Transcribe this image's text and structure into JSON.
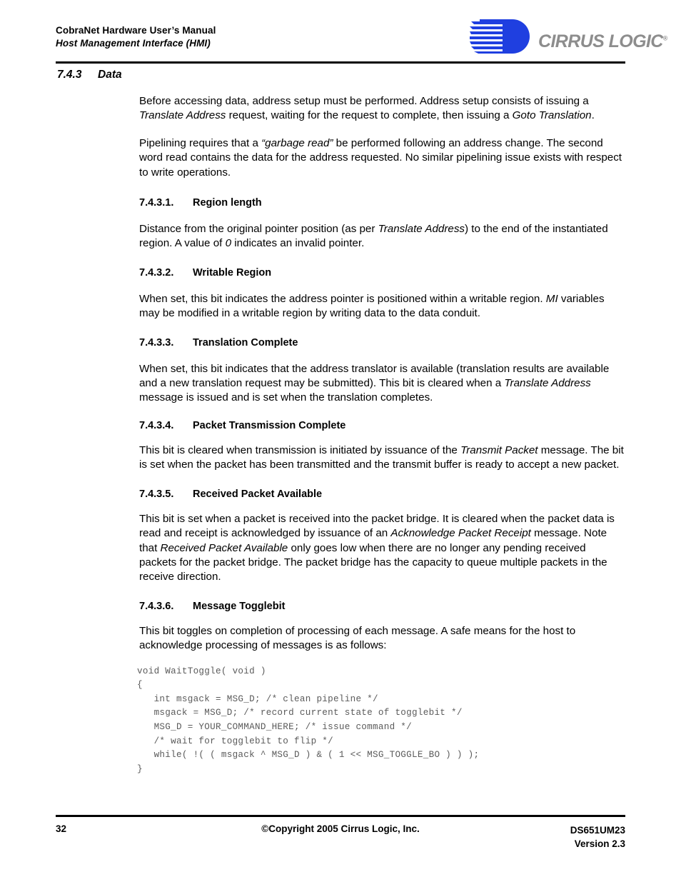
{
  "header": {
    "manual_title": "CobraNet Hardware User’s Manual",
    "chapter_title": "Host Management Interface (HMI)",
    "logo": {
      "name": "cirrus-logic-logo",
      "text": "CIRRUS LOGIC",
      "trademark": "®",
      "mark_color": "#1f3fe0",
      "text_color": "#8d8d8d"
    }
  },
  "section": {
    "number": "7.4.3",
    "title": "Data",
    "intro_paragraphs": [
      {
        "runs": [
          {
            "t": "Before accessing data, address setup must be performed. Address setup consists of issuing a "
          },
          {
            "t": "Translate Address",
            "i": true
          },
          {
            "t": " request, waiting for the request to complete, then issuing a "
          },
          {
            "t": "Goto Translation",
            "i": true
          },
          {
            "t": "."
          }
        ]
      },
      {
        "runs": [
          {
            "t": "Pipelining requires that a "
          },
          {
            "t": "“garbage read”",
            "i": true
          },
          {
            "t": " be performed following an address change. The second word read contains the data for the address requested. No similar pipelining issue exists with respect to write operations."
          }
        ]
      }
    ],
    "subsections": [
      {
        "number": "7.4.3.1.",
        "title": "Region length",
        "paragraphs": [
          {
            "runs": [
              {
                "t": "Distance from the original pointer position (as per "
              },
              {
                "t": "Translate Address",
                "i": true
              },
              {
                "t": ") to the end of the instantiated region. A value of "
              },
              {
                "t": "0",
                "i": true
              },
              {
                "t": " indicates an invalid pointer."
              }
            ]
          }
        ]
      },
      {
        "number": "7.4.3.2.",
        "title": "Writable Region",
        "paragraphs": [
          {
            "runs": [
              {
                "t": "When set, this bit indicates the address pointer is positioned within a writable region. "
              },
              {
                "t": "MI",
                "i": true
              },
              {
                "t": " variables may be modified in a writable region by writing data to the data conduit."
              }
            ]
          }
        ]
      },
      {
        "number": "7.4.3.3.",
        "title": "Translation Complete",
        "paragraphs": [
          {
            "runs": [
              {
                "t": "When set, this bit indicates that the address translator is available (translation results are available and a new translation request may be submitted). This bit is cleared when a "
              },
              {
                "t": "Translate Address",
                "i": true
              },
              {
                "t": " message is issued and is set when the translation completes."
              }
            ]
          }
        ]
      },
      {
        "number": "7.4.3.4.",
        "title": "Packet Transmission Complete",
        "paragraphs": [
          {
            "runs": [
              {
                "t": "This bit is cleared when transmission is initiated by issuance of the "
              },
              {
                "t": "Transmit Packet",
                "i": true
              },
              {
                "t": " message. The bit is set when the packet has been transmitted and the transmit buffer is ready to accept a new packet."
              }
            ]
          }
        ]
      },
      {
        "number": "7.4.3.5.",
        "title": "Received Packet Available",
        "paragraphs": [
          {
            "runs": [
              {
                "t": "This bit is set when a packet is received into the packet bridge. It is cleared when the packet data is read and receipt is acknowledged by issuance of an "
              },
              {
                "t": "Acknowledge Packet Receipt",
                "i": true
              },
              {
                "t": " message. Note that "
              },
              {
                "t": "Received Packet Available",
                "i": true
              },
              {
                "t": " only goes low when there are no longer any pending received packets for the packet bridge. The packet bridge has the capacity to queue multiple packets in the receive direction."
              }
            ]
          }
        ]
      },
      {
        "number": "7.4.3.6.",
        "title": "Message Togglebit",
        "paragraphs": [
          {
            "runs": [
              {
                "t": "This bit toggles on completion of processing of each message. A safe means for the host to acknowledge processing of messages is as follows:"
              }
            ]
          }
        ]
      }
    ],
    "code_listing": "void WaitToggle( void )\n{\n   int msgack = MSG_D; /* clean pipeline */\n   msgack = MSG_D; /* record current state of togglebit */\n   MSG_D = YOUR_COMMAND_HERE; /* issue command */\n   /* wait for togglebit to flip */\n   while( !( ( msgack ^ MSG_D ) & ( 1 << MSG_TOGGLE_BO ) ) );\n}"
  },
  "footer": {
    "page_number": "32",
    "copyright": "©Copyright 2005 Cirrus Logic, Inc.",
    "document_id": "DS651UM23",
    "version": "Version 2.3"
  }
}
